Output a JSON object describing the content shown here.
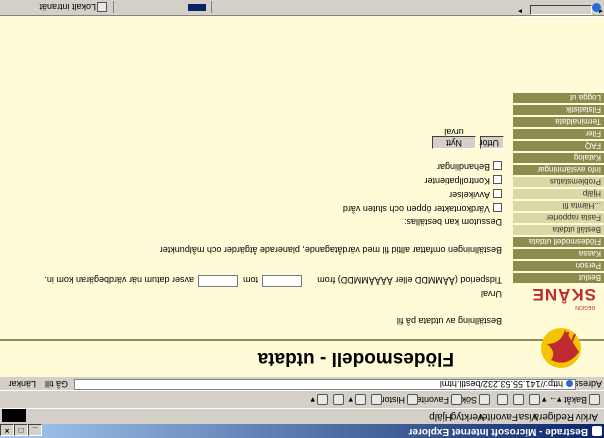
{
  "window": {
    "title": "Bestrade - Microsoft Internet Explorer"
  },
  "menu": [
    "Arkiv",
    "Redigera",
    "Visa",
    "Favoriter",
    "Verktyg",
    "Hjälp"
  ],
  "toolbar": {
    "back": "Bakåt",
    "search": "Sök",
    "favorites": "Favoriter",
    "history": "Historik"
  },
  "address": {
    "label": "Adress",
    "url": "http://141.55.53.232/bestll.html",
    "go": "Gå till",
    "links": "Länkar"
  },
  "header": {
    "title": "Flödesmodell - utdata"
  },
  "logo": {
    "text": "SKÅNE",
    "subtext": "REGION"
  },
  "sidebar": {
    "items": [
      {
        "label": "Beslut",
        "style": "dark"
      },
      {
        "label": "Person",
        "style": "dark"
      },
      {
        "label": "Kassa",
        "style": "dark"
      },
      {
        "label": "Flödesmodell utdata",
        "style": "dark"
      },
      {
        "label": "Beställ utdata",
        "style": "light"
      },
      {
        "label": "Fasta rapporter",
        "style": "light"
      },
      {
        "label": "...Hämta fil",
        "style": "light"
      },
      {
        "label": "Hjälp",
        "style": "light"
      },
      {
        "label": "Problemstatus",
        "style": "light"
      },
      {
        "label": "Info avstämningar",
        "style": "dark"
      },
      {
        "label": "Katalog",
        "style": "dark"
      },
      {
        "label": "FAQ",
        "style": "dark"
      },
      {
        "label": "Filer",
        "style": "dark"
      },
      {
        "label": "Terminaldata",
        "style": "dark"
      },
      {
        "label": "Filstatistik",
        "style": "dark"
      },
      {
        "label": "Logga ut",
        "style": "dark"
      }
    ]
  },
  "form": {
    "intro": "Beställning av utdata på fil",
    "urval": "Urval",
    "period_label": "Tidsperiod (ÅÅMMDD eller ÅÅÅÅMMDD) from",
    "period_tom": "tom",
    "period_from_value": "",
    "period_tom_value": "",
    "period_note": "avser datum när värdbegäran kom in.",
    "info_line": "Beställningen omfattar alltid fil med värdåtagande, planerade åtgärder och målpunkter",
    "extra_heading": "Dessutom kan beställas:",
    "checkboxes": [
      {
        "label": "Värdkontakter öppen och sluten vård",
        "checked": false
      },
      {
        "label": "Avvikelser",
        "checked": false
      },
      {
        "label": "Kontrollpatienter",
        "checked": false
      },
      {
        "label": "Behandlingar",
        "checked": false
      }
    ],
    "submit_label": "Utför",
    "reset_label": "Nytt urval"
  },
  "status": {
    "zone": "Lokalt intranät"
  },
  "colors": {
    "content_bg": "#fffbd6",
    "nav_dark": "#8c8c4e",
    "nav_light": "#d9d9a5",
    "logo_red": "#c0292f",
    "logo_yellow": "#f2c500",
    "titlebar": "#0a246a"
  }
}
